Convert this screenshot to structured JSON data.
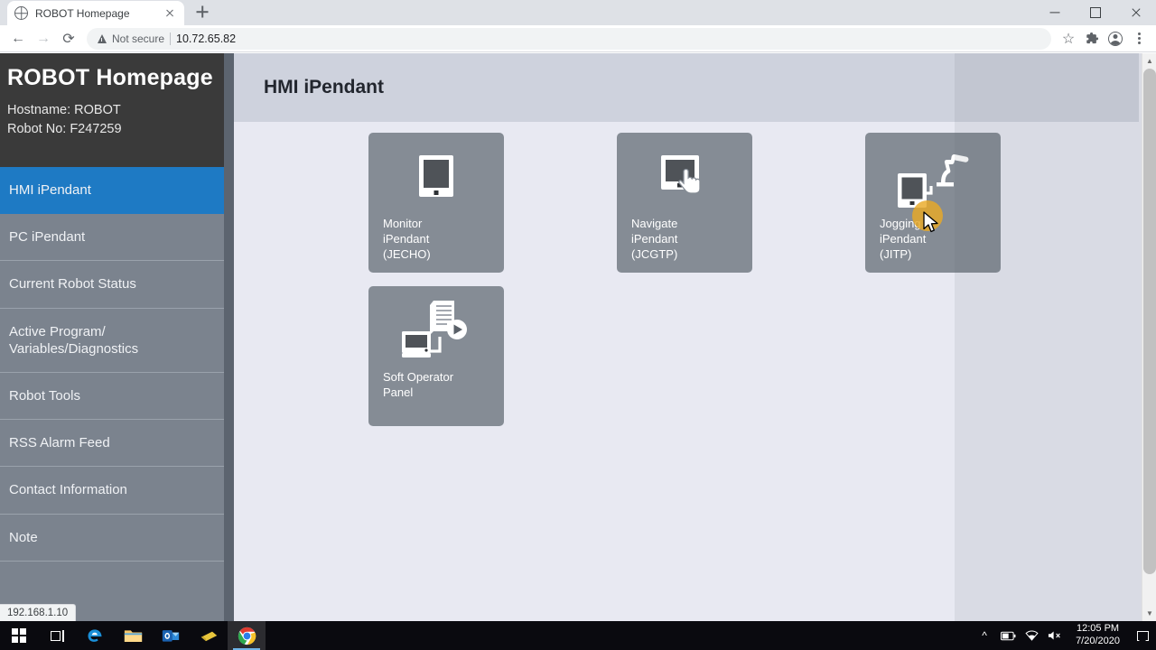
{
  "browser": {
    "tab": {
      "title": "ROBOT Homepage",
      "favicon": "globe-icon",
      "close": "×"
    },
    "new_tab_label": "+",
    "window_controls": {
      "minimize": "–",
      "maximize": "▢",
      "close": "×"
    },
    "nav": {
      "back": "←",
      "forward": "→",
      "reload": "⟳"
    },
    "omnibox": {
      "security_text": "Not secure",
      "url": "10.72.65.82",
      "separator": "|"
    },
    "actions": {
      "bookmark": "☆",
      "extensions": "puzzle-icon",
      "profile": "profile-icon",
      "menu": "kebab-icon"
    },
    "status_bubble": "192.168.1.10",
    "scrollbar": {
      "up": "▲",
      "down": "▼"
    }
  },
  "sidebar": {
    "title": "ROBOT Homepage",
    "hostname_line": "Hostname: ROBOT",
    "robot_no_line": "Robot No: F247259",
    "active_index": 0,
    "items": [
      {
        "label": "HMI iPendant"
      },
      {
        "label": "PC iPendant"
      },
      {
        "label": "Current Robot Status"
      },
      {
        "label": "Active Program/\nVariables/Diagnostics"
      },
      {
        "label": "Robot Tools"
      },
      {
        "label": "RSS Alarm Feed"
      },
      {
        "label": "Contact Information"
      },
      {
        "label": "Note"
      }
    ]
  },
  "main": {
    "title": "HMI iPendant",
    "tiles": [
      {
        "label": "Monitor\niPendant\n(JECHO)",
        "icon": "tablet-pendant-icon"
      },
      {
        "label": "Navigate\niPendant\n(JCGTP)",
        "icon": "tablet-touch-hand-icon"
      },
      {
        "label": "Jogging\niPendant\n(JITP)",
        "icon": "robot-arm-pendant-icon"
      },
      {
        "label": "Soft Operator\nPanel",
        "icon": "monitor-document-play-icon"
      }
    ]
  },
  "taskbar": {
    "start": "windows-logo-icon",
    "task_view": "task-view-icon",
    "apps": [
      {
        "name": "edge-icon"
      },
      {
        "name": "file-explorer-icon"
      },
      {
        "name": "outlook-icon"
      },
      {
        "name": "sticky-notes-icon"
      },
      {
        "name": "chrome-icon",
        "active": true
      }
    ],
    "tray": {
      "chevron": "^",
      "battery": "battery-icon",
      "wifi": "wifi-icon",
      "volume": "volume-muted-icon",
      "time": "12:05 PM",
      "date": "7/20/2020",
      "notifications": "notification-icon"
    }
  },
  "colors": {
    "accent_blue": "#1e7ac4",
    "sidebar_bg": "#7b838e",
    "sidebar_header": "#3a3a3a",
    "tile_bg": "#858c95",
    "content_bg": "#e8e9f2",
    "content_header_bg": "#ced2dd",
    "click_halo": "#e9a926"
  }
}
